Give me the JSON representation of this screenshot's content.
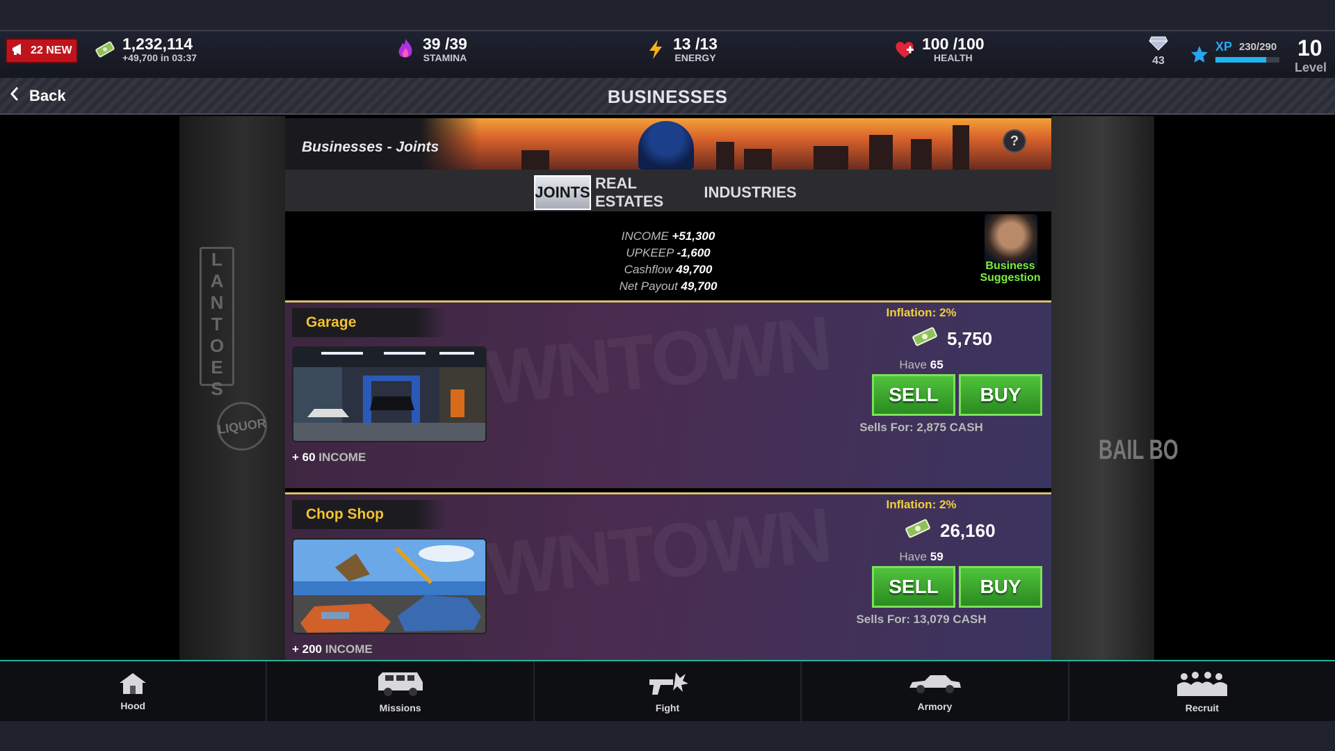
{
  "top": {
    "new_badge": "22 NEW",
    "cash": "1,232,114",
    "cash_timer": "+49,700 in 03:37",
    "stamina_value": "39 /39",
    "stamina_label": "STAMINA",
    "energy_value": "13 /13",
    "energy_label": "ENERGY",
    "health_value": "100 /100",
    "health_label": "HEALTH",
    "gems": "43",
    "xp_label": "XP",
    "xp_value": "230/290",
    "xp_fraction": 0.793,
    "level_value": "10",
    "level_label": "Level"
  },
  "titlebar": {
    "back_label": "Back",
    "title": "BUSINESSES"
  },
  "banner": {
    "label": "Businesses - Joints",
    "help": "?"
  },
  "tabs": [
    {
      "label": "JOINTS",
      "active": true
    },
    {
      "label": "REAL ESTATES",
      "active": false
    },
    {
      "label": "INDUSTRIES",
      "active": false
    }
  ],
  "summary": {
    "income_label": "INCOME",
    "income_value": "+51,300",
    "upkeep_label": "UPKEEP",
    "upkeep_value": "-1,600",
    "cashflow_label": "Cashflow",
    "cashflow_value": "49,700",
    "payout_label": "Net Payout",
    "payout_value": "49,700",
    "advisor_line1": "Business",
    "advisor_line2": "Suggestion"
  },
  "businesses": [
    {
      "name": "Garage",
      "income": "+ 60",
      "income_label": "INCOME",
      "inflation": "Inflation: 2%",
      "price": "5,750",
      "have_label": "Have",
      "have": "65",
      "sell": "SELL",
      "buy": "BUY",
      "sells_for": "Sells For: 2,875 CASH"
    },
    {
      "name": "Chop Shop",
      "income": "+ 200",
      "income_label": "INCOME",
      "inflation": "Inflation: 2%",
      "price": "26,160",
      "have_label": "Have",
      "have": "59",
      "sell": "SELL",
      "buy": "BUY",
      "sells_for": "Sells For: 13,079 CASH"
    }
  ],
  "background": {
    "sign_left": "LANTOES",
    "sign_liquor": "LIQUOR",
    "sign_right": "BAIL BO"
  },
  "nav": [
    {
      "label": "Hood",
      "icon": "house-icon"
    },
    {
      "label": "Missions",
      "icon": "van-icon"
    },
    {
      "label": "Fight",
      "icon": "gun-icon"
    },
    {
      "label": "Armory",
      "icon": "car-icon"
    },
    {
      "label": "Recruit",
      "icon": "crowd-icon"
    }
  ],
  "colors": {
    "accent_gold": "#f1c232",
    "buy_green": "#3cab2e",
    "badge_red": "#c0141c",
    "xp_blue": "#20b4f0",
    "advisor_green": "#7cf03a"
  }
}
